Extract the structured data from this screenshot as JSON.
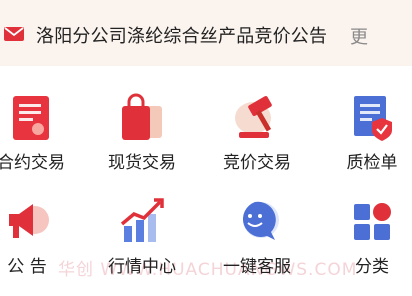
{
  "notice": {
    "icon": "mail-icon",
    "text": "洛阳分公司涤纶综合丝产品竞价公告",
    "more": "更"
  },
  "grid": [
    {
      "label": "合约交易",
      "icon": "contract-icon"
    },
    {
      "label": "现货交易",
      "icon": "shopping-bag-icon"
    },
    {
      "label": "竞价交易",
      "icon": "auction-gavel-icon"
    },
    {
      "label": "质检单",
      "icon": "quality-certificate-icon"
    },
    {
      "label": "公 告",
      "icon": "megaphone-icon"
    },
    {
      "label": "行情中心",
      "icon": "market-chart-icon"
    },
    {
      "label": "一键客服",
      "icon": "customer-service-chat-icon"
    },
    {
      "label": "分类",
      "icon": "category-grid-icon"
    }
  ],
  "watermark": "华创   WWW.HUACHUANGWS.COM"
}
